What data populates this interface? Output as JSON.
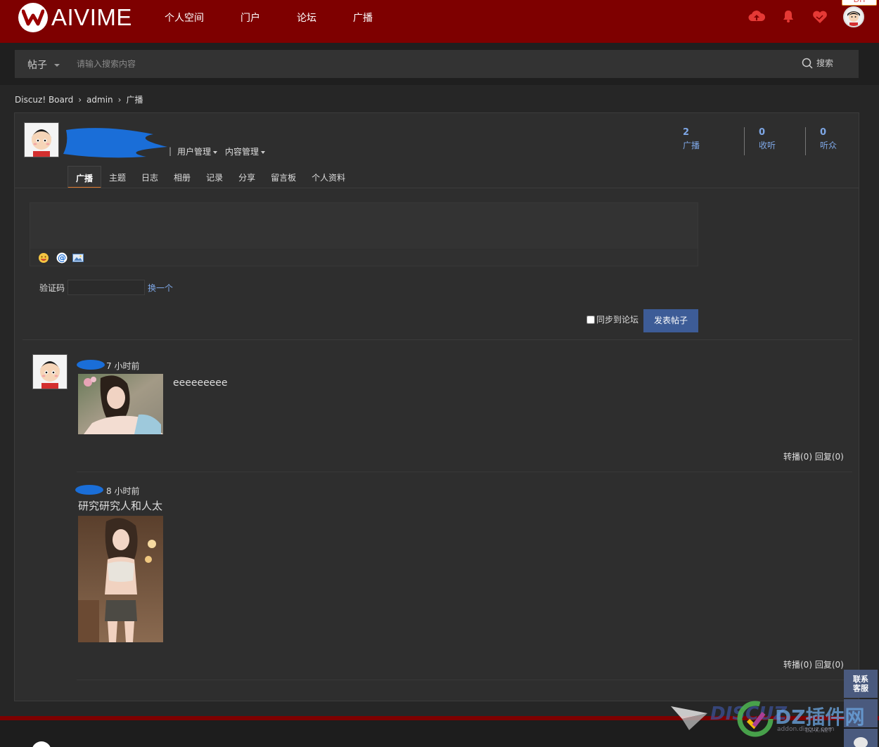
{
  "header": {
    "logo_text": "AIVIME",
    "nav": [
      "个人空间",
      "门户",
      "论坛",
      "广播"
    ],
    "badge": "DH"
  },
  "search": {
    "type_label": "帖子",
    "placeholder": "请输入搜索内容",
    "button_label": "搜索"
  },
  "breadcrumb": [
    "Discuz! Board",
    "admin",
    "广播"
  ],
  "profile": {
    "user_mgmt": "用户管理",
    "content_mgmt": "内容管理",
    "stats": [
      {
        "num": "2",
        "label": "广播"
      },
      {
        "num": "0",
        "label": "收听"
      },
      {
        "num": "0",
        "label": "听众"
      }
    ],
    "tabs": [
      "广播",
      "主题",
      "日志",
      "相册",
      "记录",
      "分享",
      "留言板",
      "个人资料"
    ]
  },
  "composer": {
    "captcha_label": "验证码",
    "captcha_change": "换一个",
    "sync_label": "同步到论坛",
    "post_button": "发表帖子"
  },
  "feed": [
    {
      "time": "7 小时前",
      "text": "eeeeeeeee",
      "actions": "转播(0)  回复(0)"
    },
    {
      "time": "8 小时前",
      "text": "研究研究人和人太",
      "actions": "转播(0)  回复(0)"
    }
  ],
  "side": {
    "contact": "联系客服"
  },
  "watermark": {
    "brand": "DISCUZ",
    "cn": "DZ插件网",
    "site": "addon.discuz.com",
    "domain": "DZ-X.NET"
  },
  "colors": {
    "header": "#7e0000",
    "accent": "#7ea7e6",
    "button": "#3d5c97",
    "tab_underline": "#e07a2e"
  }
}
